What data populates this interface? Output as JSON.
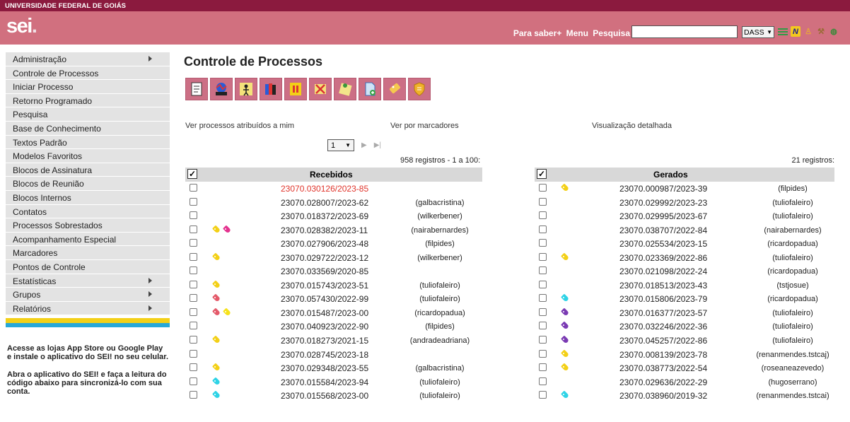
{
  "institution": "UNIVERSIDADE FEDERAL DE GOIÁS",
  "logo": {
    "text": "sei",
    "dot": "."
  },
  "header": {
    "links": [
      "Para saber+",
      "Menu",
      "Pesquisa"
    ],
    "search_value": "",
    "unit": "DASS",
    "icons": [
      "lines-icon",
      "n-icon",
      "user-icon",
      "wrench-icon",
      "globe-icon"
    ]
  },
  "sidebar": {
    "items": [
      {
        "label": "Administração",
        "submenu": true
      },
      {
        "label": "Controle de Processos",
        "submenu": false
      },
      {
        "label": "Iniciar Processo",
        "submenu": false
      },
      {
        "label": "Retorno Programado",
        "submenu": false
      },
      {
        "label": "Pesquisa",
        "submenu": false
      },
      {
        "label": "Base de Conhecimento",
        "submenu": false
      },
      {
        "label": "Textos Padrão",
        "submenu": false
      },
      {
        "label": "Modelos Favoritos",
        "submenu": false
      },
      {
        "label": "Blocos de Assinatura",
        "submenu": false
      },
      {
        "label": "Blocos de Reunião",
        "submenu": false
      },
      {
        "label": "Blocos Internos",
        "submenu": false
      },
      {
        "label": "Contatos",
        "submenu": false
      },
      {
        "label": "Processos Sobrestados",
        "submenu": false
      },
      {
        "label": "Acompanhamento Especial",
        "submenu": false
      },
      {
        "label": "Marcadores",
        "submenu": false
      },
      {
        "label": "Pontos de Controle",
        "submenu": false
      },
      {
        "label": "Estatísticas",
        "submenu": true
      },
      {
        "label": "Grupos",
        "submenu": true
      },
      {
        "label": "Relatórios",
        "submenu": true
      }
    ],
    "promo_1": "Acesse as lojas App Store ou Google Play e instale o aplicativo do SEI! no seu celular.",
    "promo_2": "Abra o aplicativo do SEI! e faça a leitura do código abaixo para sincronizá-lo com sua conta."
  },
  "main": {
    "title": "Controle de Processos",
    "toolbar": [
      "new-document-icon",
      "send-process-icon",
      "assign-process-icon",
      "include-in-block-icon",
      "suspend-process-icon",
      "conclude-process-icon",
      "annotation-icon",
      "new-process-icon",
      "marker-icon",
      "security-icon"
    ],
    "view_assigned": "Ver processos atribuídos a mim",
    "view_markers": "Ver por marcadores",
    "view_detailed": "Visualização detalhada",
    "page_select": "1",
    "received": {
      "count_label": "958 registros - 1 a 100:",
      "header": "Recebidos",
      "rows": [
        {
          "proc": "23070.030126/2023-85",
          "user": "",
          "marks": [],
          "highlight": true
        },
        {
          "proc": "23070.028007/2023-62",
          "user": "(galbacristina)",
          "marks": []
        },
        {
          "proc": "23070.018372/2023-69",
          "user": "(wilkerbener)",
          "marks": []
        },
        {
          "proc": "23070.028382/2023-11",
          "user": "(nairabernardes)",
          "marks": [
            "#f3d017",
            "#e4338f"
          ]
        },
        {
          "proc": "23070.027906/2023-48",
          "user": "(filpides)",
          "marks": []
        },
        {
          "proc": "23070.029722/2023-12",
          "user": "(wilkerbener)",
          "marks": [
            "#f3d017"
          ]
        },
        {
          "proc": "23070.033569/2020-85",
          "user": "",
          "marks": []
        },
        {
          "proc": "23070.015743/2023-51",
          "user": "(tuliofaleiro)",
          "marks": [
            "#f3d017"
          ]
        },
        {
          "proc": "23070.057430/2022-99",
          "user": "(tuliofaleiro)",
          "marks": [
            "#e45a6a"
          ]
        },
        {
          "proc": "23070.015487/2023-00",
          "user": "(ricardopadua)",
          "marks": [
            "#e45a6a",
            "#f6e21a"
          ]
        },
        {
          "proc": "23070.040923/2022-90",
          "user": "(filpides)",
          "marks": []
        },
        {
          "proc": "23070.018273/2021-15",
          "user": "(andradeadriana)",
          "marks": [
            "#f3d017"
          ]
        },
        {
          "proc": "23070.028745/2023-18",
          "user": "",
          "marks": []
        },
        {
          "proc": "23070.029348/2023-55",
          "user": "(galbacristina)",
          "marks": [
            "#f3d017"
          ]
        },
        {
          "proc": "23070.015584/2023-94",
          "user": "(tuliofaleiro)",
          "marks": [
            "#2ed3e6"
          ]
        },
        {
          "proc": "23070.015568/2023-00",
          "user": "(tuliofaleiro)",
          "marks": [
            "#2ed3e6"
          ]
        }
      ]
    },
    "generated": {
      "count_label": "21 registros:",
      "header": "Gerados",
      "rows": [
        {
          "proc": "23070.000987/2023-39",
          "user": "(filpides)",
          "marks": [
            "#f3d017"
          ]
        },
        {
          "proc": "23070.029992/2023-23",
          "user": "(tuliofaleiro)",
          "marks": []
        },
        {
          "proc": "23070.029995/2023-67",
          "user": "(tuliofaleiro)",
          "marks": []
        },
        {
          "proc": "23070.038707/2022-84",
          "user": "(nairabernardes)",
          "marks": []
        },
        {
          "proc": "23070.025534/2023-15",
          "user": "(ricardopadua)",
          "marks": []
        },
        {
          "proc": "23070.023369/2022-86",
          "user": "(tuliofaleiro)",
          "marks": [
            "#f3d017"
          ]
        },
        {
          "proc": "23070.021098/2022-24",
          "user": "(ricardopadua)",
          "marks": []
        },
        {
          "proc": "23070.018513/2023-43",
          "user": "(tstjosue)",
          "marks": []
        },
        {
          "proc": "23070.015806/2023-79",
          "user": "(ricardopadua)",
          "marks": [
            "#2ed3e6"
          ]
        },
        {
          "proc": "23070.016377/2023-57",
          "user": "(tuliofaleiro)",
          "marks": [
            "#7a3ab3"
          ]
        },
        {
          "proc": "23070.032246/2022-36",
          "user": "(tuliofaleiro)",
          "marks": [
            "#7a3ab3"
          ]
        },
        {
          "proc": "23070.045257/2022-86",
          "user": "(tuliofaleiro)",
          "marks": [
            "#7a3ab3"
          ]
        },
        {
          "proc": "23070.008139/2023-78",
          "user": "(renanmendes.tstcaj)",
          "marks": [
            "#f3d017"
          ]
        },
        {
          "proc": "23070.038773/2022-54",
          "user": "(roseaneazevedo)",
          "marks": [
            "#f3d017"
          ]
        },
        {
          "proc": "23070.029636/2022-29",
          "user": "(hugoserrano)",
          "marks": []
        },
        {
          "proc": "23070.038960/2019-32",
          "user": "(renanmendes.tstcai)",
          "marks": [
            "#2ed3e6"
          ]
        }
      ]
    }
  }
}
